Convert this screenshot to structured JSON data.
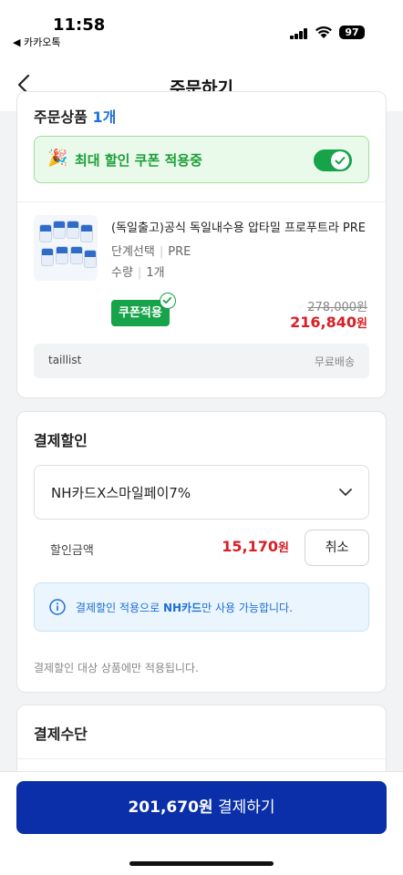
{
  "status_bar": {
    "time": "11:58",
    "back_app": "◀ 카카오톡",
    "battery": "97"
  },
  "nav": {
    "title": "주문하기"
  },
  "order_items": {
    "heading": "주문상품",
    "count": "1개",
    "coupon_banner": {
      "icon": "party-popper-icon",
      "text": "최대 할인 쿠폰 적용중",
      "toggle_on": true
    },
    "product": {
      "name": "(독일출고)공식 독일내수용 압타밀 프로푸트라 PRE",
      "option_label": "단계선택",
      "option_value": "PRE",
      "qty_label": "수량",
      "qty_value": "1개",
      "coupon_tag": "쿠폰적용",
      "original_price": "278,000",
      "original_unit": "원",
      "sale_price": "216,840",
      "sale_unit": "원"
    },
    "seller": {
      "name": "taillist",
      "shipping": "무료배송"
    }
  },
  "payment_discount": {
    "title": "결제할인",
    "selected_card": "NH카드X스마일페이7%",
    "discount_label": "할인금액",
    "discount_amount": "15,170",
    "discount_unit": "원",
    "cancel_label": "취소",
    "info_prefix": "결제할인 적용으로 ",
    "info_bold": "NH카드",
    "info_suffix": "만 사용 가능합니다.",
    "note": "결제할인 대상 상품에만 적용됩니다."
  },
  "payment_method": {
    "title": "결제수단"
  },
  "checkout": {
    "amount": "201,670원",
    "label": " 결제하기"
  },
  "colors": {
    "accent_green": "#16a34a",
    "price_red": "#d81f26",
    "pay_button": "#0a2fa8",
    "info_blue": "#1f6fd6"
  }
}
